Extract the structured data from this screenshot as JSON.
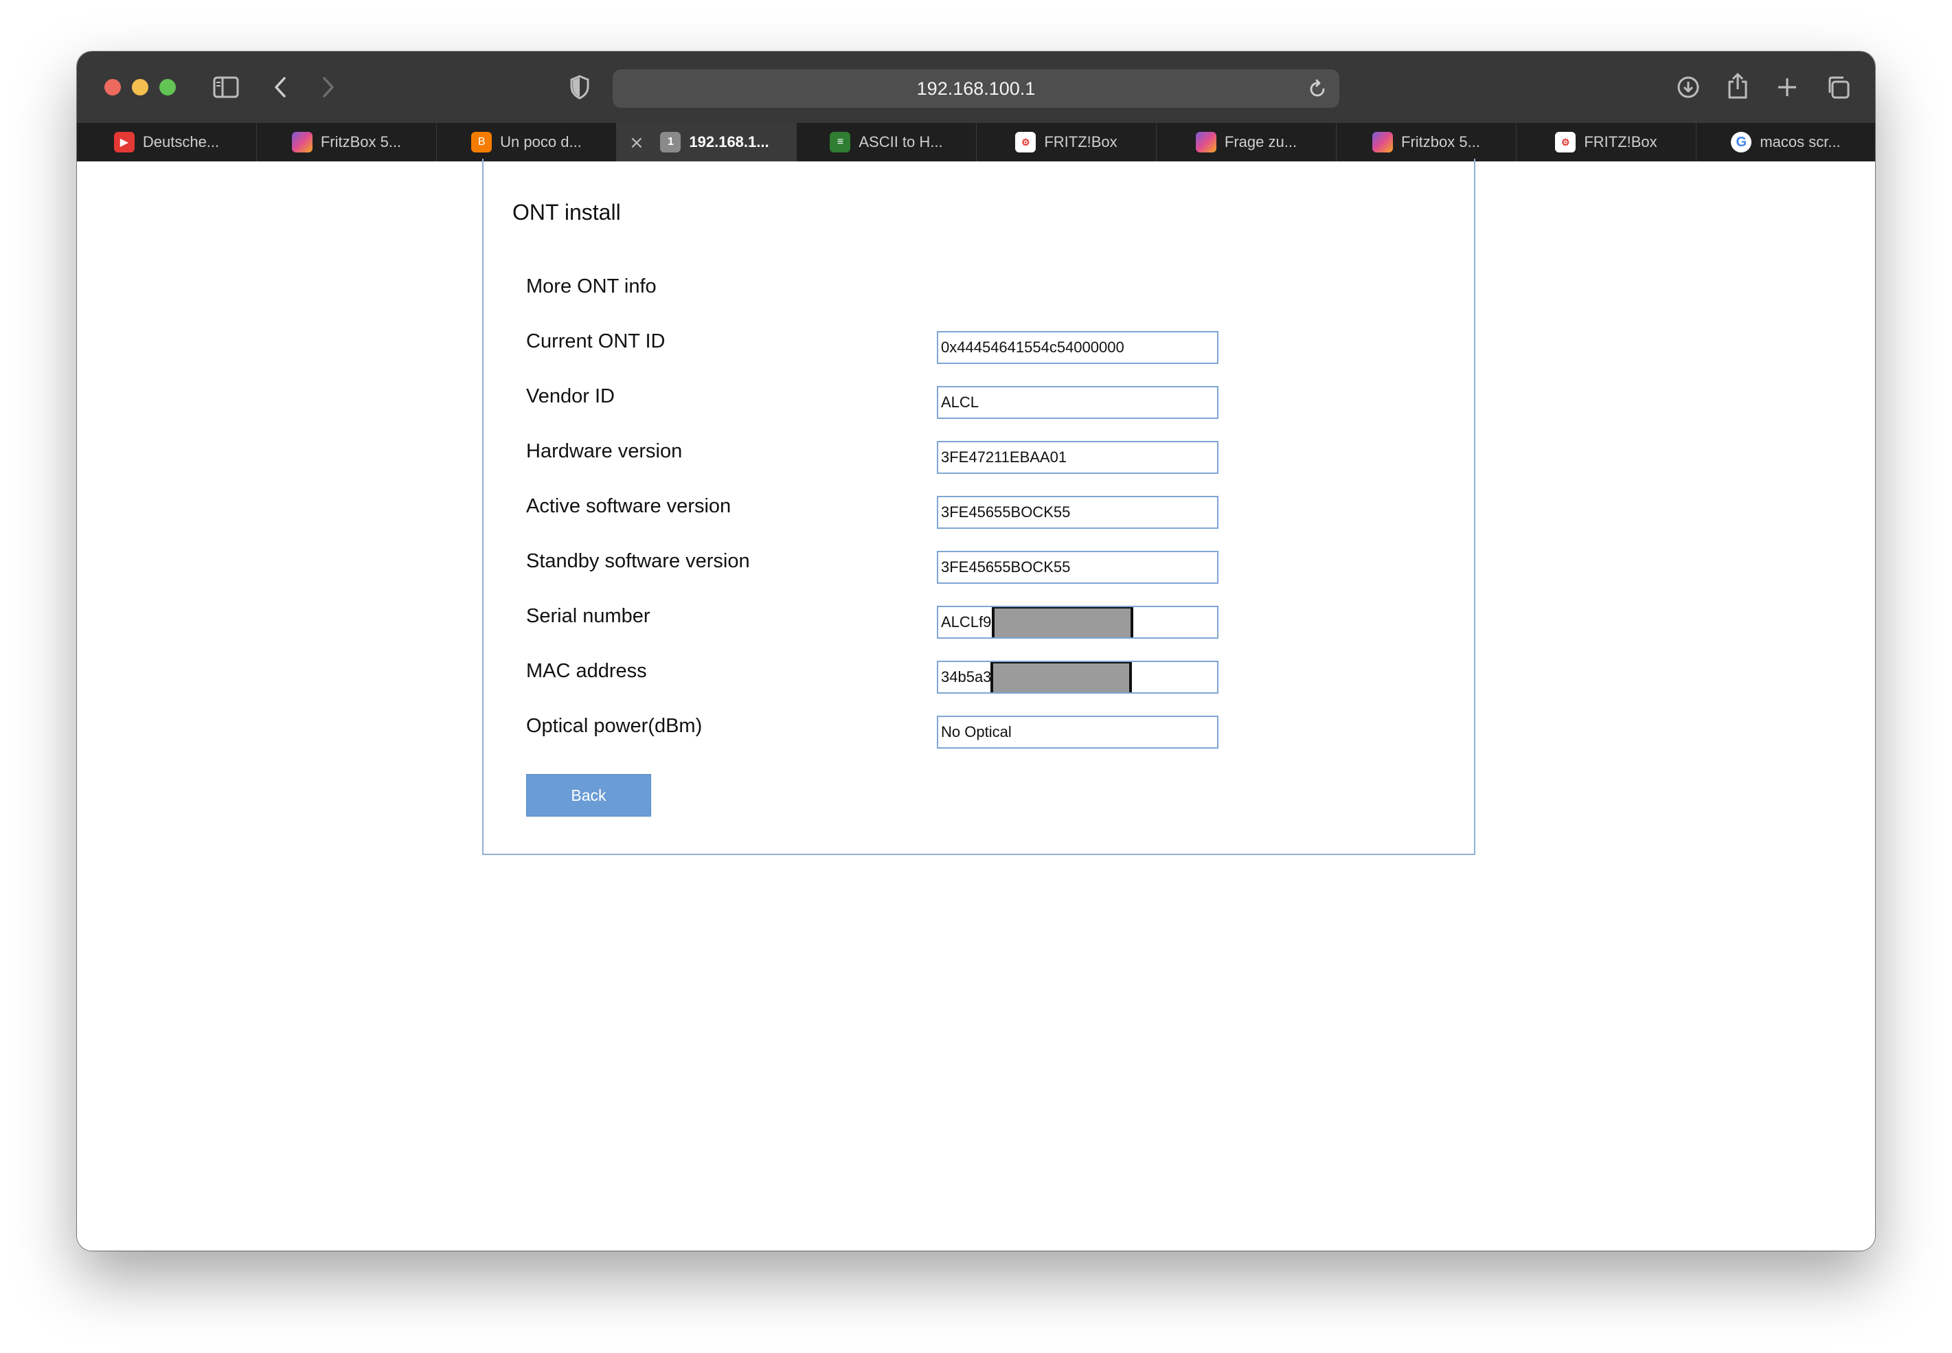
{
  "browser": {
    "address": "192.168.100.1",
    "tabs": [
      {
        "label": "Deutsche...",
        "icon": "youtube-icon",
        "color": "#e53935"
      },
      {
        "label": "FritzBox 5...",
        "icon": "site-icon",
        "color": "#7b5cd6"
      },
      {
        "label": "Un poco d...",
        "icon": "blogger-icon",
        "color": "#f57c00"
      },
      {
        "label": "192.168.1...",
        "icon": "number-one-icon",
        "color": "#8a8a8a",
        "badge": "1"
      },
      {
        "label": "ASCII to H...",
        "icon": "site-icon",
        "color": "#4caf50"
      },
      {
        "label": "FRITZ!Box",
        "icon": "fritzbox-icon",
        "color": "#e53935"
      },
      {
        "label": "Frage zu...",
        "icon": "site-icon",
        "color": "#7b5cd6"
      },
      {
        "label": "Fritzbox 5...",
        "icon": "site-icon",
        "color": "#7b5cd6"
      },
      {
        "label": "FRITZ!Box",
        "icon": "fritzbox-icon",
        "color": "#e53935"
      },
      {
        "label": "macos scr...",
        "icon": "google-icon",
        "color": "#4285f4"
      }
    ]
  },
  "page": {
    "title": "ONT install",
    "section": "More ONT info",
    "rows": [
      {
        "label": "Current ONT ID",
        "value": "0x44454641554c54000000"
      },
      {
        "label": "Vendor ID",
        "value": "ALCL"
      },
      {
        "label": "Hardware version",
        "value": "3FE47211EBAA01"
      },
      {
        "label": "Active software version",
        "value": "3FE45655BOCK55"
      },
      {
        "label": "Standby software version",
        "value": "3FE45655BOCK55"
      },
      {
        "label": "Serial number",
        "value": "ALCLf9"
      },
      {
        "label": "MAC address",
        "value": "34b5a3"
      },
      {
        "label": "Optical power(dBm)",
        "value": "No Optical"
      }
    ],
    "back_label": "Back"
  },
  "colors": {
    "accent": "#6a9cd5",
    "panel_border": "#8fb1d8"
  }
}
